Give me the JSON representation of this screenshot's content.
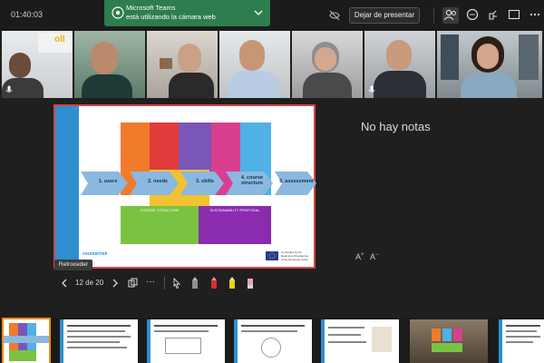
{
  "topbar": {
    "timer": "01:40:03",
    "toast": {
      "title": "Microsoft Teams",
      "message": "está utilizando la cámara web"
    },
    "stop_presenting_label": "Dejar de presentar"
  },
  "participants": {
    "tile_1_badge": "oll"
  },
  "slide": {
    "logo_text": "counterrisk",
    "steps": [
      "1. users",
      "2. needs",
      "3. skills",
      "4. course structure",
      "5. assessment"
    ],
    "bottom_left_label": "COURSE STRUCTURE",
    "bottom_right_label": "SUSTAINABILITY PROPOSAL",
    "eu_line_1": "Co-funded by the",
    "eu_line_2": "Erasmus+ Programme",
    "eu_line_3": "of the European Union"
  },
  "notes": {
    "empty_text": "No hay notas"
  },
  "font_controls": {
    "increase": "A",
    "decrease": "A"
  },
  "tooltip": {
    "text": "Retroceder"
  },
  "toolbar": {
    "page_indicator": "12 de 20",
    "more": "···"
  },
  "colors": {
    "topbar_bg": "#1b1b1b",
    "toast_bg": "#2e7d4f",
    "selection_outline": "#7b83eb",
    "slide_border": "#d64545",
    "thumb_selected": "#ff8c1a"
  }
}
